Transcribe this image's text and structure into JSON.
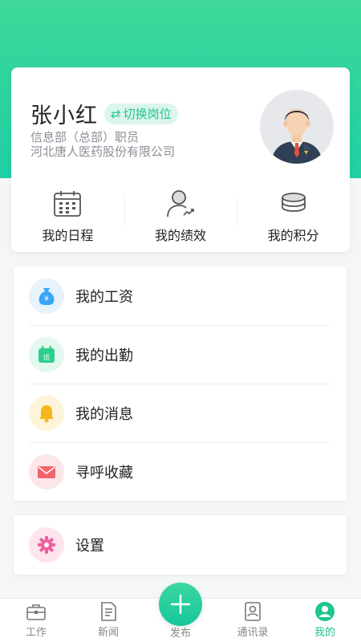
{
  "profile": {
    "name": "张小红",
    "switch_label": "切换岗位",
    "department": "信息部（总部）职员",
    "company": "河北唐人医药股份有限公司"
  },
  "quick_actions": [
    {
      "label": "我的日程",
      "icon": "calendar-icon"
    },
    {
      "label": "我的绩效",
      "icon": "performance-icon"
    },
    {
      "label": "我的积分",
      "icon": "coins-icon"
    }
  ],
  "menu": [
    {
      "label": "我的工资",
      "icon": "money-bag-icon",
      "color": "#3aa5f5"
    },
    {
      "label": "我的出勤",
      "icon": "attendance-icon",
      "color": "#2ecf8c"
    },
    {
      "label": "我的消息",
      "icon": "bell-icon",
      "color": "#f5b81c"
    },
    {
      "label": "寻呼收藏",
      "icon": "envelope-icon",
      "color": "#f2636b"
    }
  ],
  "settings": {
    "label": "设置",
    "icon": "gear-icon",
    "color": "#ef5f9e"
  },
  "tabbar": {
    "items": [
      {
        "label": "工作",
        "icon": "briefcase-icon"
      },
      {
        "label": "新闻",
        "icon": "news-icon"
      },
      {
        "label": "发布",
        "icon": "plus-icon"
      },
      {
        "label": "通讯录",
        "icon": "contacts-icon"
      },
      {
        "label": "我的",
        "icon": "me-icon"
      }
    ],
    "active_index": 4
  },
  "colors": {
    "brand": "#1ec690",
    "header_gradient": [
      "#3ed89a",
      "#1fcfa4"
    ]
  }
}
